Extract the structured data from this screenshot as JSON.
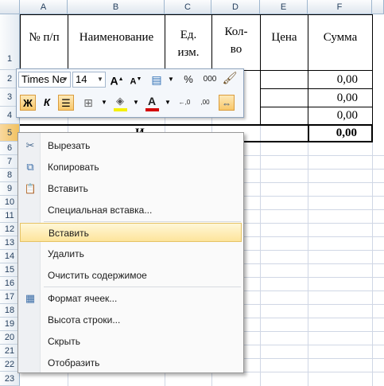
{
  "columns": [
    "A",
    "B",
    "C",
    "D",
    "E",
    "F"
  ],
  "rows": [
    "1",
    "2",
    "3",
    "4",
    "5",
    "6",
    "7",
    "8",
    "9",
    "10",
    "11",
    "12",
    "13",
    "14",
    "15",
    "16",
    "17",
    "18",
    "19",
    "20",
    "21",
    "22",
    "23"
  ],
  "table": {
    "headers": [
      "№ п/п",
      "Наименование",
      "Ед.\nизм.",
      "Кол-\nво",
      "Цена",
      "Сумма"
    ],
    "sum_values": [
      "0,00",
      "0,00",
      "0,00"
    ],
    "total_label": "И",
    "total_value": "0,00"
  },
  "minibar": {
    "font_name": "Times Ne",
    "font_size": "14",
    "bold": "Ж",
    "italic": "К",
    "grow": "A",
    "shrink": "A",
    "percent": "%",
    "thousands": "000",
    "inc_decimals": "←,0",
    "dec_decimals": ",00",
    "colors": {
      "fill": "#f5f000",
      "font": "#d40000"
    }
  },
  "menu": {
    "items": [
      {
        "label": "Вырезать",
        "icon": "scissors-icon",
        "glyph": "✂"
      },
      {
        "label": "Копировать",
        "icon": "copy-icon",
        "glyph": "⧉"
      },
      {
        "label": "Вставить",
        "icon": "paste-icon",
        "glyph": "📋"
      },
      {
        "label": "Специальная вставка...",
        "icon": "",
        "glyph": ""
      },
      {
        "label": "Вставить",
        "icon": "",
        "glyph": "",
        "highlighted": true
      },
      {
        "label": "Удалить",
        "icon": "",
        "glyph": ""
      },
      {
        "label": "Очистить содержимое",
        "icon": "",
        "glyph": ""
      },
      {
        "label": "Формат ячеек...",
        "icon": "format-cells-icon",
        "glyph": "▦"
      },
      {
        "label": "Высота строки...",
        "icon": "",
        "glyph": ""
      },
      {
        "label": "Скрыть",
        "icon": "",
        "glyph": ""
      },
      {
        "label": "Отобразить",
        "icon": "",
        "glyph": ""
      }
    ]
  }
}
